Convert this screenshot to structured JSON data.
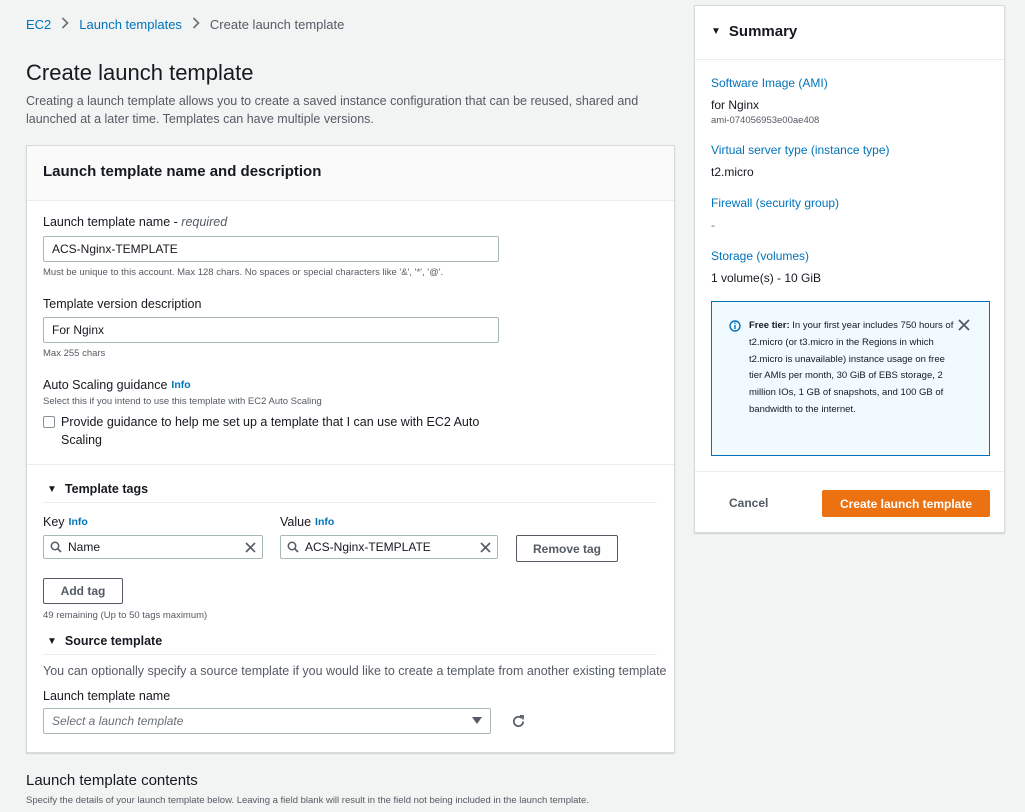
{
  "breadcrumb": {
    "item1": "EC2",
    "item2": "Launch templates",
    "item3": "Create launch template"
  },
  "page": {
    "title": "Create launch template",
    "description": "Creating a launch template allows you to create a saved instance configuration that can be reused, shared and launched at a later time. Templates can have multiple versions."
  },
  "name_section": {
    "header": "Launch template name and description",
    "name_label": "Launch template name - ",
    "name_required": "required",
    "name_value": "ACS-Nginx-TEMPLATE",
    "name_hint": "Must be unique to this account. Max 128 chars. No spaces or special characters like '&', '*', '@'.",
    "desc_label": "Template version description",
    "desc_value": "For Nginx",
    "desc_hint": "Max 255 chars",
    "asg_label": "Auto Scaling guidance",
    "asg_info": "Info",
    "asg_hint": "Select this if you intend to use this template with EC2 Auto Scaling",
    "asg_checkbox_label": "Provide guidance to help me set up a template that I can use with EC2 Auto Scaling"
  },
  "tags_section": {
    "title": "Template tags",
    "key_label": "Key",
    "value_label": "Value",
    "info": "Info",
    "key_value": "Name",
    "value_value": "ACS-Nginx-TEMPLATE",
    "remove_tag": "Remove tag",
    "add_tag": "Add tag",
    "remaining": "49 remaining (Up to 50 tags maximum)"
  },
  "source_section": {
    "title": "Source template",
    "description": "You can optionally specify a source template if you would like to create a template from another existing template",
    "label": "Launch template name",
    "placeholder": "Select a launch template"
  },
  "contents": {
    "title": "Launch template contents",
    "description": "Specify the details of your launch template below. Leaving a field blank will result in the field not being included in the launch template."
  },
  "summary": {
    "title": "Summary",
    "ami_label": "Software Image (AMI)",
    "ami_value": "for Nginx",
    "ami_id": "ami-074056953e00ae408",
    "instance_label": "Virtual server type (instance type)",
    "instance_value": "t2.micro",
    "firewall_label": "Firewall (security group)",
    "firewall_value": "-",
    "storage_label": "Storage (volumes)",
    "storage_value": "1 volume(s) - 10 GiB",
    "free_tier_bold": "Free tier:",
    "free_tier_text": " In your first year includes 750 hours of t2.micro (or t3.micro in the Regions in which t2.micro is unavailable) instance usage on free tier AMIs per month, 30 GiB of EBS storage, 2 million IOs, 1 GB of snapshots, and 100 GB of bandwidth to the internet.",
    "cancel": "Cancel",
    "create": "Create launch template"
  }
}
